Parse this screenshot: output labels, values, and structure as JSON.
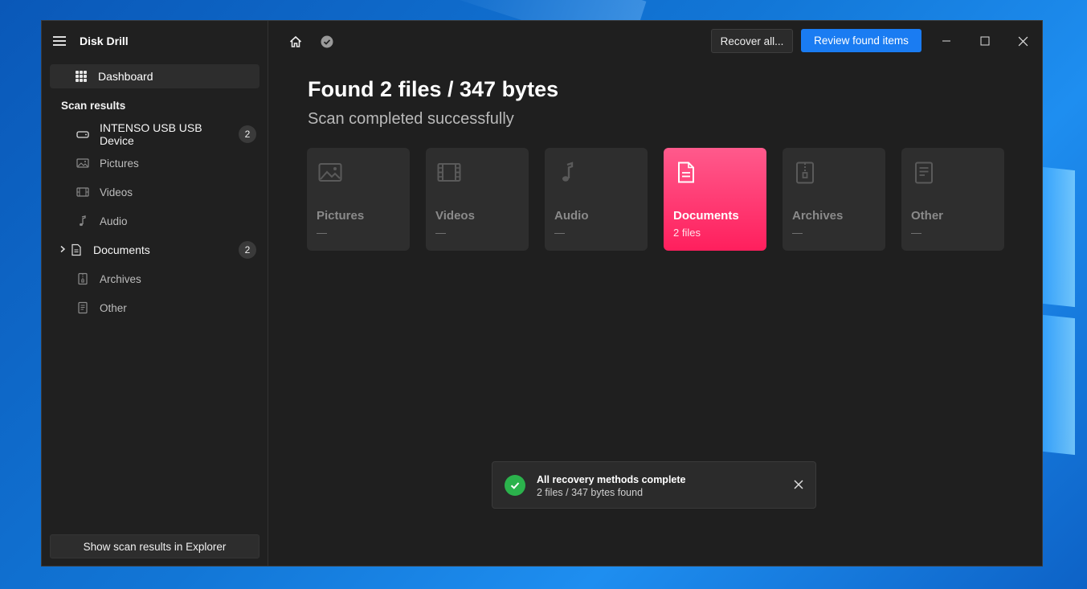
{
  "app": {
    "title": "Disk Drill"
  },
  "sidebar": {
    "dashboard_label": "Dashboard",
    "section_label": "Scan results",
    "items": [
      {
        "label": "INTENSO USB USB Device",
        "icon": "drive-icon",
        "count": "2"
      },
      {
        "label": "Pictures",
        "icon": "pictures-icon"
      },
      {
        "label": "Videos",
        "icon": "videos-icon"
      },
      {
        "label": "Audio",
        "icon": "audio-icon"
      },
      {
        "label": "Documents",
        "icon": "document-icon",
        "count": "2"
      },
      {
        "label": "Archives",
        "icon": "archive-icon"
      },
      {
        "label": "Other",
        "icon": "other-file-icon"
      }
    ],
    "footer_button": "Show scan results in Explorer"
  },
  "toolbar": {
    "recover_all_label": "Recover all...",
    "review_label": "Review found items"
  },
  "main": {
    "headline": "Found 2 files / 347 bytes",
    "subline": "Scan completed successfully"
  },
  "categories": [
    {
      "name": "Pictures",
      "count": "—",
      "icon": "pictures-icon"
    },
    {
      "name": "Videos",
      "count": "—",
      "icon": "videos-icon"
    },
    {
      "name": "Audio",
      "count": "—",
      "icon": "audio-icon"
    },
    {
      "name": "Documents",
      "count": "2 files",
      "icon": "document-icon",
      "active": true
    },
    {
      "name": "Archives",
      "count": "—",
      "icon": "archive-icon"
    },
    {
      "name": "Other",
      "count": "—",
      "icon": "other-file-icon"
    }
  ],
  "toast": {
    "title": "All recovery methods complete",
    "message": "2 files / 347 bytes found"
  },
  "colors": {
    "accent_blue": "#1a7cf2",
    "active_card": "#ff2a63",
    "success": "#2bb24c",
    "background": "#202020"
  }
}
